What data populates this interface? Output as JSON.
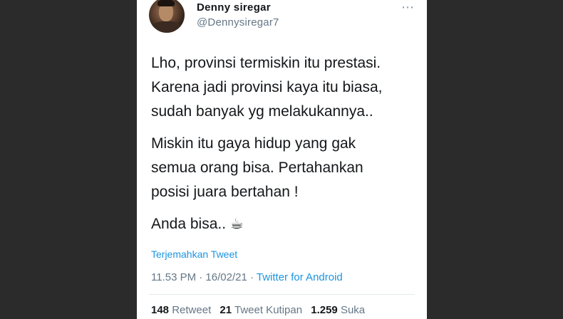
{
  "tweet": {
    "author": {
      "name": "Denny siregar",
      "handle": "@Dennysiregar7"
    },
    "more_icon": "⋯",
    "paragraphs": [
      "Lho, provinsi termiskin itu prestasi.\nKarena jadi provinsi kaya itu biasa,\nsudah banyak yg melakukannya..",
      "Miskin itu gaya hidup yang gak\nsemua orang bisa. Pertahankan\nposisi juara bertahan !",
      "Anda bisa.. ☕"
    ],
    "translate_label": "Terjemahkan Tweet",
    "time": "11.53 PM · 16/02/21 · ",
    "source": "Twitter for Android",
    "stats": {
      "retweets_count": "148",
      "retweets_label": "Retweet",
      "quotes_count": "21",
      "quotes_label": "Tweet Kutipan",
      "likes_count": "1.259",
      "likes_label": "Suka"
    }
  }
}
